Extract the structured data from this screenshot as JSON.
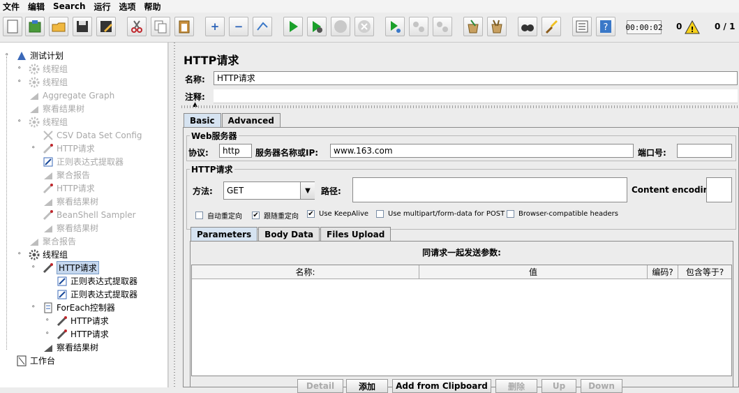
{
  "menu": [
    "文件",
    "编辑",
    "Search",
    "运行",
    "选项",
    "帮助"
  ],
  "toolbar": {
    "icons": [
      "new-icon",
      "templates-icon",
      "open-icon",
      "save-icon",
      "save-as-icon",
      "cut-icon",
      "copy-icon",
      "paste-icon",
      "expand-icon",
      "collapse-icon",
      "toggle-icon",
      "start-icon",
      "start-no-pause-icon",
      "stop-icon",
      "shutdown-icon",
      "remote-start-icon",
      "remote-stop-icon",
      "remote-shutdown-icon",
      "clear-icon",
      "clear-all-icon",
      "search-icon",
      "reset-search-icon",
      "function-helper-icon",
      "help-icon"
    ],
    "timer": "00:00:02",
    "error_count": "0",
    "threads": "0 / 1"
  },
  "tree": [
    {
      "label": "测试计划",
      "icon": "test-plan-icon",
      "disabled": false
    },
    {
      "label": "线程组",
      "icon": "gear-icon",
      "disabled": true
    },
    {
      "label": "线程组",
      "icon": "gear-icon",
      "disabled": true
    },
    {
      "label": "Aggregate Graph",
      "icon": "graph-icon",
      "disabled": true
    },
    {
      "label": "察看结果树",
      "icon": "graph-icon",
      "disabled": true
    },
    {
      "label": "线程组",
      "icon": "gear-icon",
      "disabled": true
    },
    {
      "label": "CSV Data Set Config",
      "icon": "wrench-icon",
      "disabled": true
    },
    {
      "label": "HTTP请求",
      "icon": "pipette-icon",
      "disabled": true
    },
    {
      "label": "正则表达式提取器",
      "icon": "extractor-icon",
      "disabled": true
    },
    {
      "label": "聚合报告",
      "icon": "graph-icon",
      "disabled": true
    },
    {
      "label": "HTTP请求",
      "icon": "pipette-icon",
      "disabled": true
    },
    {
      "label": "察看结果树",
      "icon": "graph-icon",
      "disabled": true
    },
    {
      "label": "BeanShell Sampler",
      "icon": "pipette-icon",
      "disabled": true
    },
    {
      "label": "察看结果树",
      "icon": "graph-icon",
      "disabled": true
    },
    {
      "label": "聚合报告",
      "icon": "graph-icon",
      "disabled": true
    },
    {
      "label": "线程组",
      "icon": "gear-icon",
      "disabled": false
    },
    {
      "label": "HTTP请求",
      "icon": "pipette-icon",
      "disabled": false,
      "selected": true
    },
    {
      "label": "正则表达式提取器",
      "icon": "extractor-icon",
      "disabled": false
    },
    {
      "label": "正则表达式提取器",
      "icon": "extractor-icon",
      "disabled": false
    },
    {
      "label": "ForEach控制器",
      "icon": "controller-icon",
      "disabled": false
    },
    {
      "label": "HTTP请求",
      "icon": "pipette-icon",
      "disabled": false
    },
    {
      "label": "HTTP请求",
      "icon": "pipette-icon",
      "disabled": false
    },
    {
      "label": "察看结果树",
      "icon": "graph-icon",
      "disabled": false
    },
    {
      "label": "工作台",
      "icon": "workbench-icon",
      "disabled": false
    }
  ],
  "panel": {
    "title": "HTTP请求",
    "name_label": "名称:",
    "name_value": "HTTP请求",
    "comment_label": "注释:",
    "tabs": [
      "Basic",
      "Advanced"
    ],
    "web_server": {
      "legend": "Web服务器",
      "protocol_label": "协议:",
      "protocol_value": "http",
      "server_label": "服务器名称或IP:",
      "server_value": "www.163.com",
      "port_label": "端口号:",
      "port_value": ""
    },
    "http_request": {
      "legend": "HTTP请求",
      "method_label": "方法:",
      "method_value": "GET",
      "path_label": "路径:",
      "path_value": "",
      "encoding_label": "Content encoding:",
      "encoding_value": ""
    },
    "checkboxes": [
      {
        "label": "自动重定向",
        "checked": false
      },
      {
        "label": "跟随重定向",
        "checked": true
      },
      {
        "label": "Use KeepAlive",
        "checked": true
      },
      {
        "label": "Use multipart/form-data for POST",
        "checked": false
      },
      {
        "label": "Browser-compatible headers",
        "checked": false
      }
    ],
    "param_tabs": [
      "Parameters",
      "Body Data",
      "Files Upload"
    ],
    "table_caption": "同请求一起发送参数:",
    "columns": [
      "名称:",
      "值",
      "编码?",
      "包含等于?"
    ],
    "buttons": [
      "Detail",
      "添加",
      "Add from Clipboard",
      "删除",
      "Up",
      "Down"
    ]
  },
  "colors": {
    "selected_bg": "#c5d7ee",
    "active_tab": "#d6e3f1",
    "disabled_text": "#a8a8a8"
  }
}
